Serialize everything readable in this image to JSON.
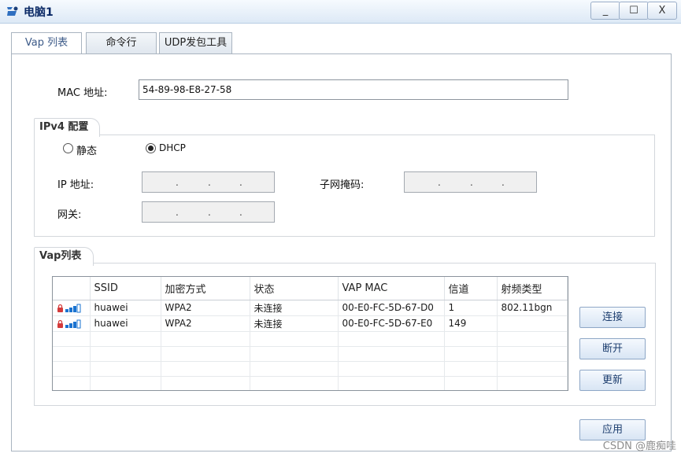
{
  "window": {
    "title": "电脑1",
    "minimize": "_",
    "maximize": "☐",
    "close": "X"
  },
  "tabs": [
    {
      "label": "Vap 列表",
      "active": true
    },
    {
      "label": "命令行",
      "active": false
    },
    {
      "label": "UDP发包工具",
      "active": false
    }
  ],
  "mac": {
    "label": "MAC 地址:",
    "value": "54-89-98-E8-27-58"
  },
  "ipv4": {
    "title": "IPv4 配置",
    "static_label": "静态",
    "dhcp_label": "DHCP",
    "selected": "DHCP",
    "ip_label": "IP 地址:",
    "mask_label": "子网掩码:",
    "gateway_label": "网关:",
    "ip_separator": "."
  },
  "vap": {
    "title": "Vap列表",
    "columns": [
      "",
      "SSID",
      "加密方式",
      "状态",
      "VAP MAC",
      "信道",
      "射频类型"
    ],
    "rows": [
      {
        "ssid": "huawei",
        "encryption": "WPA2",
        "status": "未连接",
        "mac": "00-E0-FC-5D-67-D0",
        "channel": "1",
        "radio": "802.11bgn"
      },
      {
        "ssid": "huawei",
        "encryption": "WPA2",
        "status": "未连接",
        "mac": "00-E0-FC-5D-67-E0",
        "channel": "149",
        "radio": ""
      }
    ],
    "connect_button": "连接",
    "disconnect_button": "断开",
    "refresh_button": "更新"
  },
  "apply_button": "应用",
  "watermark": "CSDN @鹿痴哇",
  "colors": {
    "title_text": "#0b2a66",
    "signal_bar": "#1a73d0",
    "lock": "#d43b3b"
  }
}
